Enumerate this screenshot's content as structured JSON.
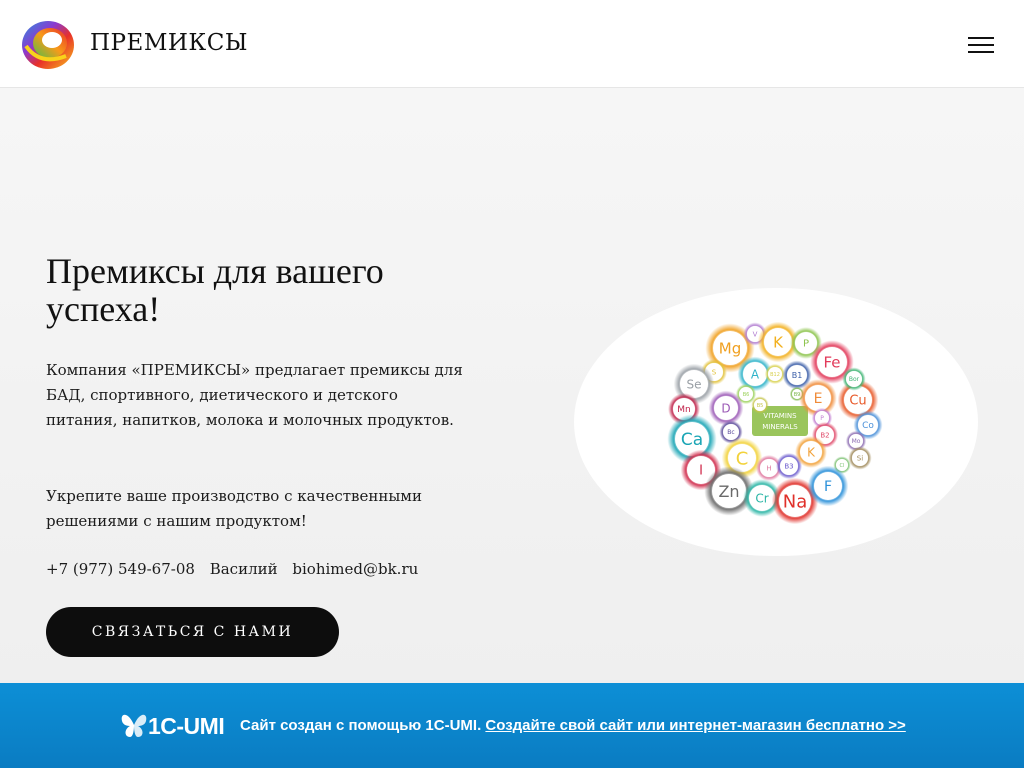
{
  "header": {
    "site_name": "ПРЕМИКСЫ",
    "logo_icon": "swirl-logo-icon",
    "menu_icon": "hamburger-menu-icon"
  },
  "hero": {
    "title": "Премиксы для вашего успеха!",
    "paragraph_1": "Компания «ПРЕМИКСЫ» предлагает премиксы для БАД, спортивного, диетического и детского питания, напитков, молока и молочных продуктов.",
    "paragraph_2": "Укрепите ваше производство с качественными решениями с нашим продуктом!",
    "phone": "+7 (977) 549-67-08",
    "contact_name": "Василий",
    "email": "biohimed@bk.ru",
    "cta_label": "СВЯЗАТЬСЯ С НАМИ"
  },
  "illustration": {
    "center_lines": [
      "VITAMINS",
      "MINERALS"
    ],
    "elements": [
      {
        "label": "Mg",
        "color": "#f0a020"
      },
      {
        "label": "V",
        "color": "#b07ad0"
      },
      {
        "label": "K",
        "color": "#f2b01e"
      },
      {
        "label": "P",
        "color": "#8bc34a"
      },
      {
        "label": "Fe",
        "color": "#e23a5a"
      },
      {
        "label": "S",
        "color": "#e2c23a"
      },
      {
        "label": "A",
        "color": "#2fb3c9"
      },
      {
        "label": "B12",
        "color": "#d7d04a"
      },
      {
        "label": "B1",
        "color": "#3b5ea8"
      },
      {
        "label": "B6",
        "color": "#9bd15a"
      },
      {
        "label": "B9",
        "color": "#7ab648"
      },
      {
        "label": "Se",
        "color": "#9aa0a6"
      },
      {
        "label": "Mn",
        "color": "#c0234a"
      },
      {
        "label": "B5",
        "color": "#c4c44a"
      },
      {
        "label": "D",
        "color": "#9b59b6"
      },
      {
        "label": "E",
        "color": "#f08c3a"
      },
      {
        "label": "P",
        "color": "#c07ad0"
      },
      {
        "label": "Cu",
        "color": "#e85a2a"
      },
      {
        "label": "Bor",
        "color": "#3cb371"
      },
      {
        "label": "Ca",
        "color": "#1aa5b5"
      },
      {
        "label": "Bc",
        "color": "#5a4a9a"
      },
      {
        "label": "B2",
        "color": "#e04a6a"
      },
      {
        "label": "Co",
        "color": "#4a90d9"
      },
      {
        "label": "Mo",
        "color": "#8a6ab0"
      },
      {
        "label": "I",
        "color": "#d02a4a"
      },
      {
        "label": "C",
        "color": "#f2d23a"
      },
      {
        "label": "H",
        "color": "#e07aa0"
      },
      {
        "label": "B3",
        "color": "#6a5acd"
      },
      {
        "label": "K",
        "color": "#f2a23a"
      },
      {
        "label": "Cl",
        "color": "#7ac070"
      },
      {
        "label": "Si",
        "color": "#a08a5a"
      },
      {
        "label": "Zn",
        "color": "#6a6a6a"
      },
      {
        "label": "Cr",
        "color": "#2ab5a5"
      },
      {
        "label": "Na",
        "color": "#e0302a"
      },
      {
        "label": "F",
        "color": "#2a90d9"
      }
    ]
  },
  "footer": {
    "brand": "1C-UMI",
    "brand_icon": "butterfly-icon",
    "text": "Сайт создан с помощью 1C-UMI.",
    "link_text": "Создайте свой сайт или интернет-магазин бесплатно >>"
  }
}
